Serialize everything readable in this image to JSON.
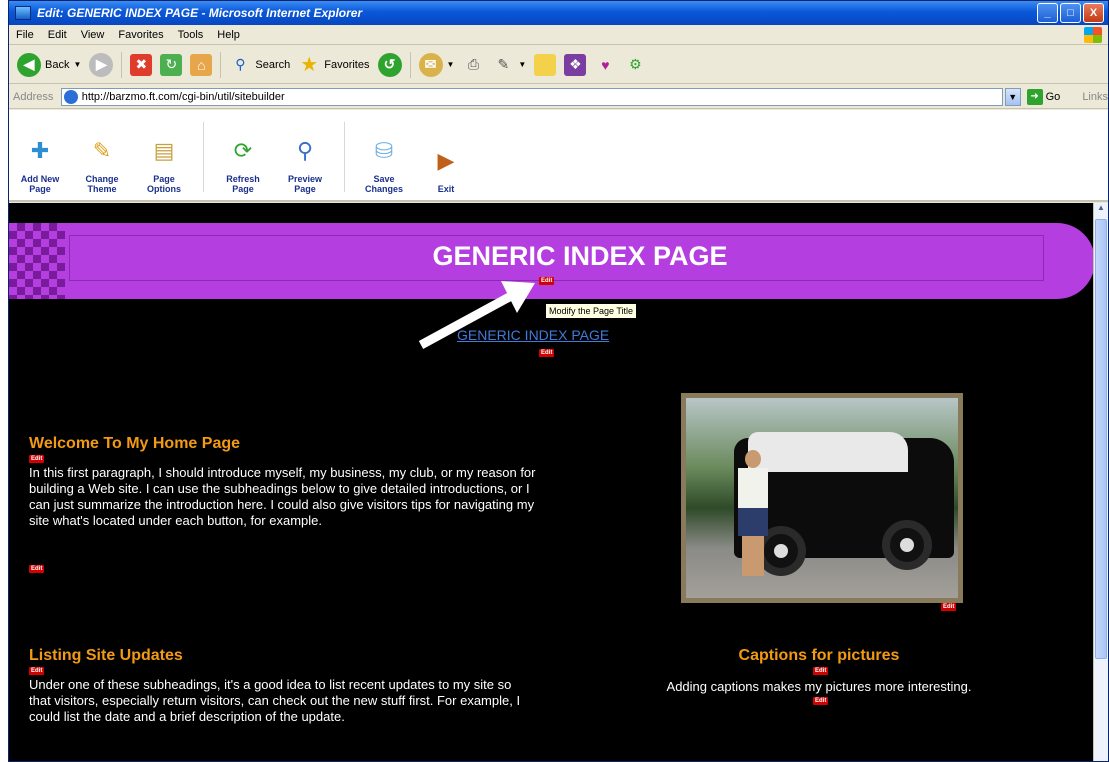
{
  "window": {
    "title": "Edit: GENERIC INDEX PAGE - Microsoft Internet Explorer",
    "controls": [
      "_",
      "□",
      "X"
    ]
  },
  "menu": [
    "File",
    "Edit",
    "View",
    "Favorites",
    "Tools",
    "Help"
  ],
  "ie_toolbar": {
    "back_label": "Back",
    "search_label": "Search",
    "favorites_label": "Favorites"
  },
  "address_bar": {
    "label": "Address",
    "url": "http://barzmo.ft.com/cgi-bin/util/sitebuilder",
    "go_label": "Go",
    "links_label": "Links"
  },
  "sitebuilder_toolbar": [
    {
      "label": "Add New\nPage",
      "icon": "add-page-icon",
      "color": "#2d8fd1"
    },
    {
      "label": "Change\nTheme",
      "icon": "paintbrush-icon",
      "color": "#e0a020"
    },
    {
      "label": "Page\nOptions",
      "icon": "clipboard-icon",
      "color": "#c8a040"
    },
    {
      "label": "Refresh\nPage",
      "icon": "refresh-icon",
      "color": "#2ea32e"
    },
    {
      "label": "Preview\nPage",
      "icon": "magnifier-icon",
      "color": "#3a70c8"
    },
    {
      "label": "Save\nChanges",
      "icon": "save-icon",
      "color": "#6fb0e0"
    },
    {
      "label": "Exit",
      "icon": "exit-door-icon",
      "color": "#c06018"
    }
  ],
  "page": {
    "banner_title": "GENERIC INDEX PAGE",
    "edit_tag": "Edit",
    "tooltip": "Modify the Page Title",
    "subtitle_link": "GENERIC INDEX PAGE",
    "section1_heading": "Welcome To My Home Page",
    "section1_text": "In this first paragraph, I should introduce myself, my business, my club, or my reason for building a Web site. I can use the subheadings below to give detailed introductions, or I can just summarize the introduction here. I could also give visitors tips for navigating my site what's located under each button, for example.",
    "section2_heading": "Listing Site Updates",
    "section2_text": "Under one of these subheadings, it's a good idea to list recent updates to my site so that visitors, especially return visitors, can check out the new stuff first. For example, I could list the date and a brief description of the update.",
    "caption_heading": "Captions for pictures",
    "caption_text": "Adding captions makes my pictures more interesting."
  },
  "colors": {
    "banner": "#b43ee0",
    "heading": "#f29a14",
    "edit_tag": "#d20000",
    "link": "#3f7bd8"
  }
}
